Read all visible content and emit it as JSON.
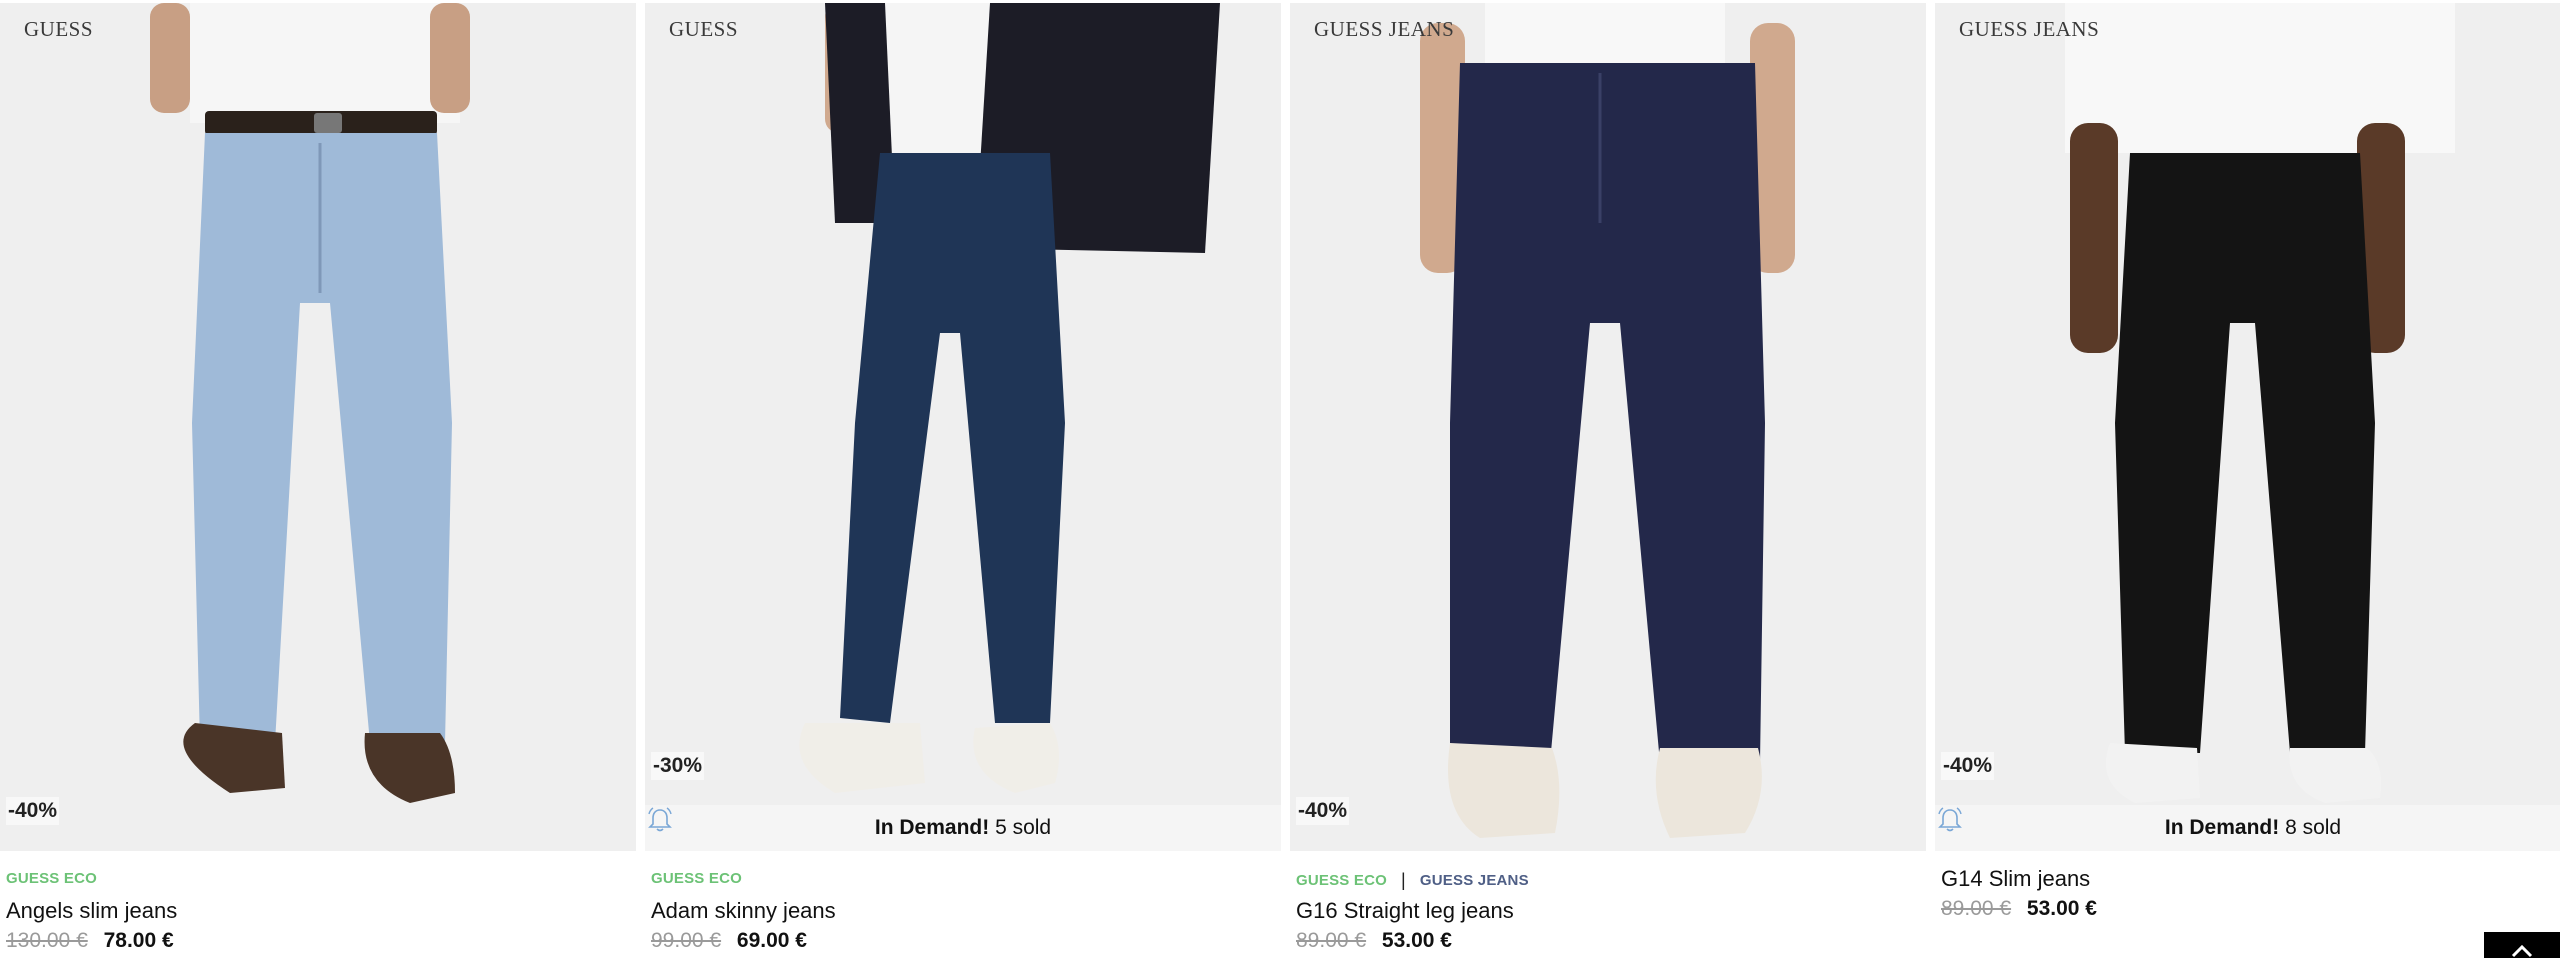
{
  "products": [
    {
      "brand": "GUESS",
      "discount": "-40%",
      "demand": null,
      "tags": [
        "GUESS ECO"
      ],
      "name": "Angels slim jeans",
      "old_price": "130.00 €",
      "new_price": "78.00 €",
      "denim_color": "#9fbad8",
      "image": "model-light-blue-slim-jeans"
    },
    {
      "brand": "GUESS",
      "discount": "-30%",
      "demand": {
        "label": "In Demand!",
        "count": "5 sold"
      },
      "tags": [
        "GUESS ECO"
      ],
      "name": "Adam skinny jeans",
      "old_price": "99.00 €",
      "new_price": "69.00 €",
      "denim_color": "#1f3556",
      "image": "model-dark-blue-skinny-jeans"
    },
    {
      "brand": "GUESS JEANS",
      "discount": "-40%",
      "demand": null,
      "tags": [
        "GUESS ECO",
        "|",
        "GUESS JEANS"
      ],
      "name": "G16 Straight leg jeans",
      "old_price": "89.00 €",
      "new_price": "53.00 €",
      "denim_color": "#23284a",
      "image": "model-raw-indigo-straight-jeans"
    },
    {
      "brand": "GUESS JEANS",
      "discount": "-40%",
      "demand": {
        "label": "In Demand!",
        "count": "8 sold"
      },
      "tags": [],
      "name": "G14 Slim jeans",
      "old_price": "89.00 €",
      "new_price": "53.00 €",
      "denim_color": "#141414",
      "image": "model-black-slim-jeans"
    }
  ],
  "back_to_top_icon": "chevron-up-icon"
}
